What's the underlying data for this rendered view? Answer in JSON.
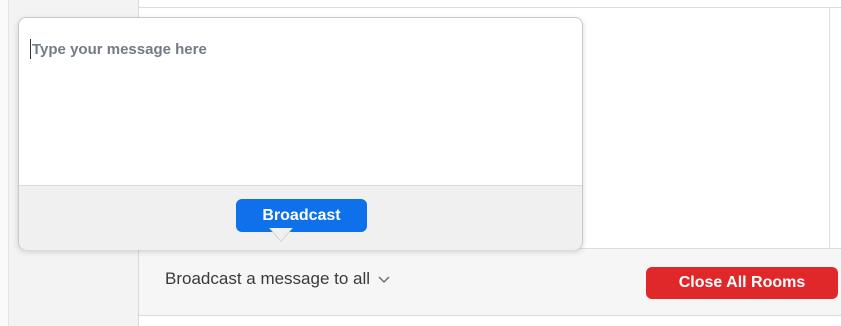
{
  "popup": {
    "placeholder": "Type your message here",
    "broadcast_label": "Broadcast"
  },
  "bottom_bar": {
    "broadcast_all_label": "Broadcast a message to all",
    "dropdown_icon": "chevron-down-icon",
    "close_all_label": "Close All Rooms"
  },
  "colors": {
    "primary_blue": "#0e71eb",
    "danger_red": "#e0282a"
  }
}
